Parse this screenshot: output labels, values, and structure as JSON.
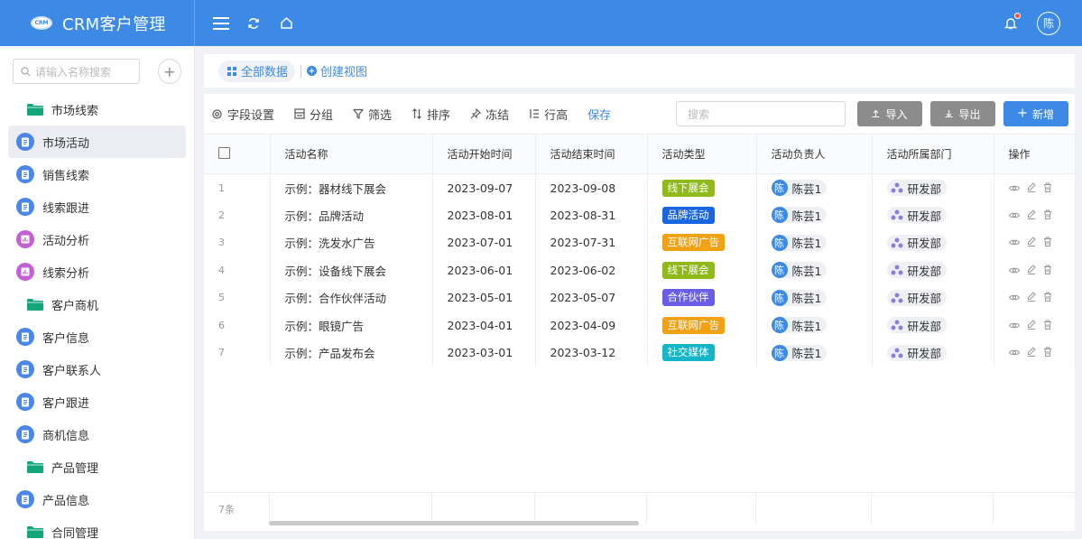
{
  "header": {
    "logo_text": "CRM",
    "title": "CRM客户管理",
    "avatar": "陈"
  },
  "sidebar": {
    "search_placeholder": "请输入名称搜索",
    "groups": [
      {
        "label": "市场线索",
        "items": [
          {
            "label": "市场活动",
            "icon": "doc-icon",
            "active": true
          },
          {
            "label": "销售线索",
            "icon": "doc-icon"
          },
          {
            "label": "线索跟进",
            "icon": "doc-icon"
          },
          {
            "label": "活动分析",
            "icon": "chart-icon"
          },
          {
            "label": "线索分析",
            "icon": "chart-icon"
          }
        ]
      },
      {
        "label": "客户商机",
        "items": [
          {
            "label": "客户信息",
            "icon": "doc-icon"
          },
          {
            "label": "客户联系人",
            "icon": "doc-icon"
          },
          {
            "label": "客户跟进",
            "icon": "doc-icon"
          },
          {
            "label": "商机信息",
            "icon": "doc-icon"
          }
        ]
      },
      {
        "label": "产品管理",
        "items": [
          {
            "label": "产品信息",
            "icon": "doc-icon"
          }
        ]
      },
      {
        "label": "合同管理",
        "items": []
      }
    ]
  },
  "views": {
    "current": "全部数据",
    "create": "创建视图"
  },
  "toolbar": {
    "fields": "字段设置",
    "group": "分组",
    "filter": "筛选",
    "sort": "排序",
    "freeze": "冻结",
    "row_height": "行高",
    "save": "保存",
    "search_placeholder": "搜索",
    "import": "导入",
    "export": "导出",
    "new": "新增"
  },
  "table": {
    "columns": [
      "活动名称",
      "活动开始时间",
      "活动结束时间",
      "活动类型",
      "活动负责人",
      "活动所属部门",
      "操作"
    ],
    "rows": [
      {
        "idx": "1",
        "name": "示例：器材线下展会",
        "start": "2023-09-07",
        "end": "2023-09-08",
        "type": "线下展会",
        "type_color": "#8fba1a",
        "owner_avatar": "陈",
        "owner": "陈芸1",
        "dept": "研发部"
      },
      {
        "idx": "2",
        "name": "示例：品牌活动",
        "start": "2023-08-01",
        "end": "2023-08-31",
        "type": "品牌活动",
        "type_color": "#1a66e0",
        "owner_avatar": "陈",
        "owner": "陈芸1",
        "dept": "研发部"
      },
      {
        "idx": "3",
        "name": "示例：洗发水广告",
        "start": "2023-07-01",
        "end": "2023-07-31",
        "type": "互联网广告",
        "type_color": "#f0a114",
        "owner_avatar": "陈",
        "owner": "陈芸1",
        "dept": "研发部"
      },
      {
        "idx": "4",
        "name": "示例：设备线下展会",
        "start": "2023-06-01",
        "end": "2023-06-02",
        "type": "线下展会",
        "type_color": "#8fba1a",
        "owner_avatar": "陈",
        "owner": "陈芸1",
        "dept": "研发部"
      },
      {
        "idx": "5",
        "name": "示例：合作伙伴活动",
        "start": "2023-05-01",
        "end": "2023-05-07",
        "type": "合作伙伴",
        "type_color": "#6a5ee6",
        "owner_avatar": "陈",
        "owner": "陈芸1",
        "dept": "研发部"
      },
      {
        "idx": "6",
        "name": "示例：眼镜广告",
        "start": "2023-04-01",
        "end": "2023-04-09",
        "type": "互联网广告",
        "type_color": "#f0a114",
        "owner_avatar": "陈",
        "owner": "陈芸1",
        "dept": "研发部"
      },
      {
        "idx": "7",
        "name": "示例：产品发布会",
        "start": "2023-03-01",
        "end": "2023-03-12",
        "type": "社交媒体",
        "type_color": "#13b5c9",
        "owner_avatar": "陈",
        "owner": "陈芸1",
        "dept": "研发部"
      }
    ],
    "count": "7条"
  }
}
